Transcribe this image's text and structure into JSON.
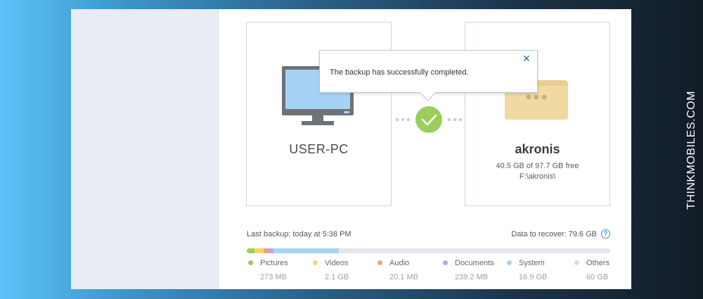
{
  "source": {
    "name": "USER-PC",
    "icon": "monitor-icon"
  },
  "destination": {
    "name": "akronis",
    "space": "40.5 GB of 97.7 GB free",
    "path": "F:\\akronis\\",
    "icon": "folder-icon"
  },
  "notification": {
    "message": "The backup has successfully completed.",
    "close_icon": "close-icon"
  },
  "status": {
    "last_backup": "Last backup: today at 5:38 PM",
    "data_to_recover": "Data to recover: 79.6 GB"
  },
  "categories": [
    {
      "label": "Pictures",
      "size": "273 MB",
      "color": "#9ccf5a"
    },
    {
      "label": "Videos",
      "size": "2.1 GB",
      "color": "#f2d96a"
    },
    {
      "label": "Audio",
      "size": "20.1 MB",
      "color": "#f2a66a"
    },
    {
      "label": "Documents",
      "size": "239.2 MB",
      "color": "#c8a0e0"
    },
    {
      "label": "System",
      "size": "16.9 GB",
      "color": "#a9d3f3"
    },
    {
      "label": "Others",
      "size": "60 GB",
      "color": "#dcdcdc"
    }
  ],
  "watermark": "THINKMOBILES.COM",
  "colors": {
    "accent": "#2e6fb7",
    "success": "#9ccf5a",
    "card_border": "#c9d6e6"
  }
}
